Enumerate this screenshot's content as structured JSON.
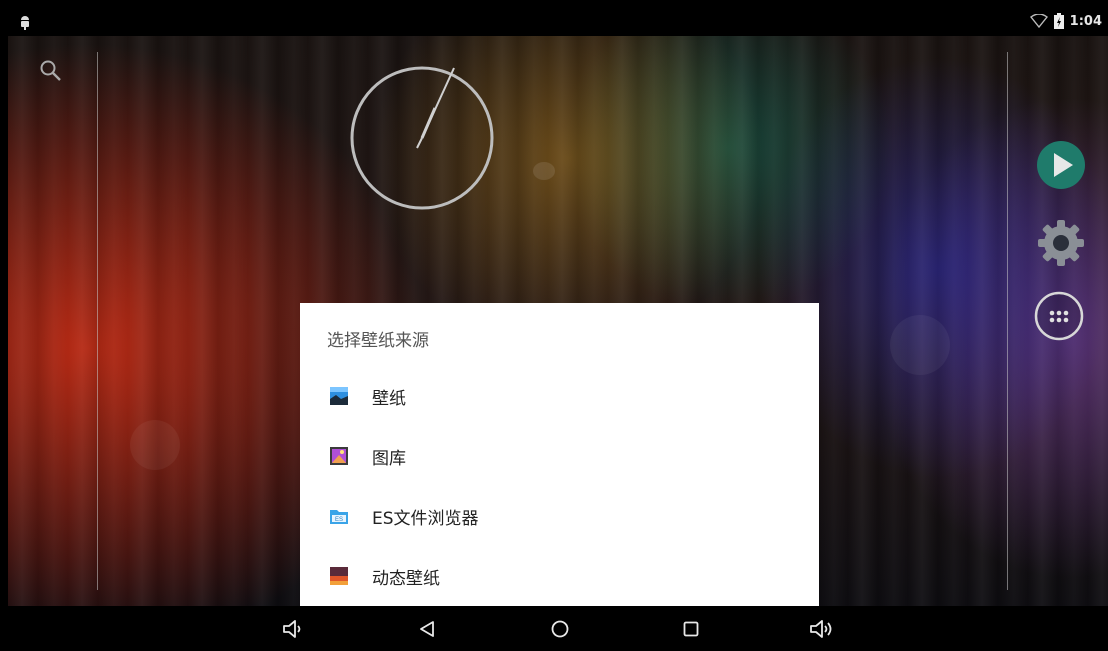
{
  "status_bar": {
    "time": "1:04",
    "icons": [
      "android-debug-icon",
      "wifi-icon",
      "battery-charging-icon"
    ]
  },
  "home": {
    "icons": [
      "search-icon",
      "analog-clock",
      "play-store-icon",
      "settings-gear-icon",
      "all-apps-icon"
    ]
  },
  "dialog": {
    "title": "选择壁纸来源",
    "options": [
      {
        "label": "壁纸",
        "icon": "wallpaper-icon"
      },
      {
        "label": "图库",
        "icon": "gallery-icon"
      },
      {
        "label": "ES文件浏览器",
        "icon": "es-file-explorer-icon"
      },
      {
        "label": "动态壁纸",
        "icon": "live-wallpaper-icon"
      }
    ]
  },
  "nav_bar": {
    "buttons": [
      "volume-down-icon",
      "back-icon",
      "home-icon",
      "recents-icon",
      "volume-up-icon"
    ]
  },
  "colors": {
    "dialog_bg": "#ffffff",
    "play_button": "#1e7a6a",
    "bar_bg": "#000000"
  }
}
